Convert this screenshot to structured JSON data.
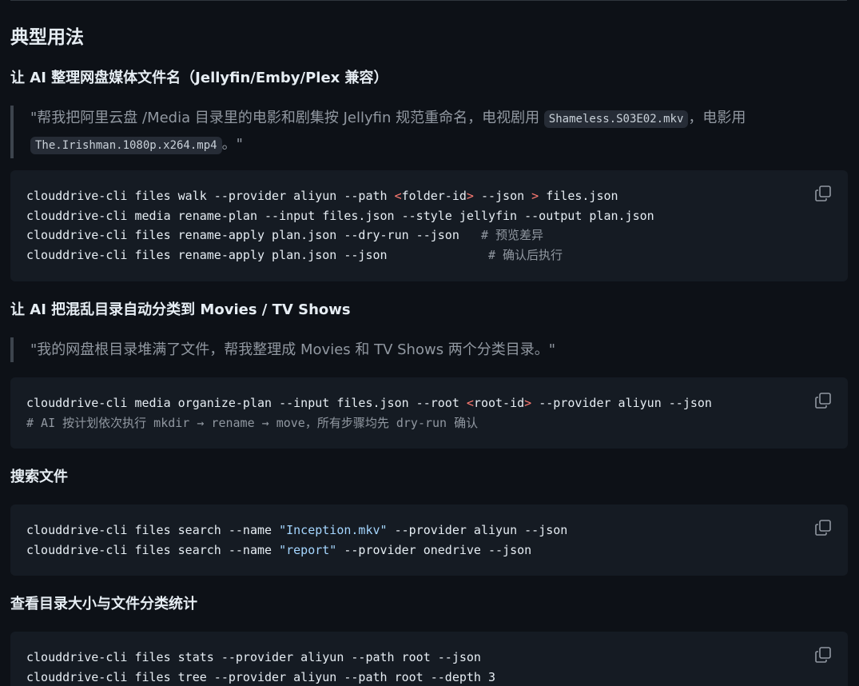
{
  "heading": "典型用法",
  "sections": [
    {
      "title": "让 AI 整理网盘媒体文件名（Jellyfin/Emby/Plex 兼容）",
      "quote": {
        "part1": "\"帮我把阿里云盘 /Media 目录里的电影和剧集按 Jellyfin 规范重命名，电视剧用 ",
        "code1": "Shameless.S03E02.mkv",
        "part2": "，电影用",
        "code2": "The.Irishman.1080p.x264.mp4",
        "part3": "。\""
      },
      "code": [
        {
          "a": "clouddrive-cli files walk --provider aliyun --path ",
          "r1": "<",
          "b": "folder-id",
          "r2": ">",
          "c": " --json ",
          "r3": ">",
          "d": " files.json"
        },
        {
          "text": "clouddrive-cli media rename-plan --input files.json --style jellyfin --output plan.json"
        },
        {
          "text": "clouddrive-cli files rename-apply plan.json --dry-run --json   ",
          "comment": "# 预览差异"
        },
        {
          "text": "clouddrive-cli files rename-apply plan.json --json              ",
          "comment": "# 确认后执行"
        }
      ]
    },
    {
      "title": "让 AI 把混乱目录自动分类到 Movies / TV Shows",
      "quote": "\"我的网盘根目录堆满了文件，帮我整理成 Movies 和 TV Shows 两个分类目录。\"",
      "code": [
        {
          "a": "clouddrive-cli media organize-plan --input files.json --root ",
          "r1": "<",
          "b": "root-id",
          "r2": ">",
          "c": " --provider aliyun --json"
        },
        {
          "comment": "# AI 按计划依次执行 mkdir → rename → move，所有步骤均先 dry-run 确认"
        }
      ]
    },
    {
      "title": "搜索文件",
      "code": [
        {
          "a": "clouddrive-cli files search --name ",
          "s": "\"Inception.mkv\"",
          "c": " --provider aliyun --json"
        },
        {
          "a": "clouddrive-cli files search --name ",
          "s": "\"report\"",
          "c": " --provider onedrive --json"
        }
      ]
    },
    {
      "title": "查看目录大小与文件分类统计",
      "code": [
        {
          "text": "clouddrive-cli files stats --provider aliyun --path root --json"
        },
        {
          "text": "clouddrive-cli files tree --provider aliyun --path root --depth 3"
        }
      ]
    }
  ],
  "icons": {
    "copy": "copy-icon"
  },
  "colors": {
    "background": "#0d1117",
    "code_bg": "#151b23",
    "keyword_red": "#ff7b72",
    "string_blue": "#a5d6ff",
    "comment_gray": "#9198a1"
  }
}
